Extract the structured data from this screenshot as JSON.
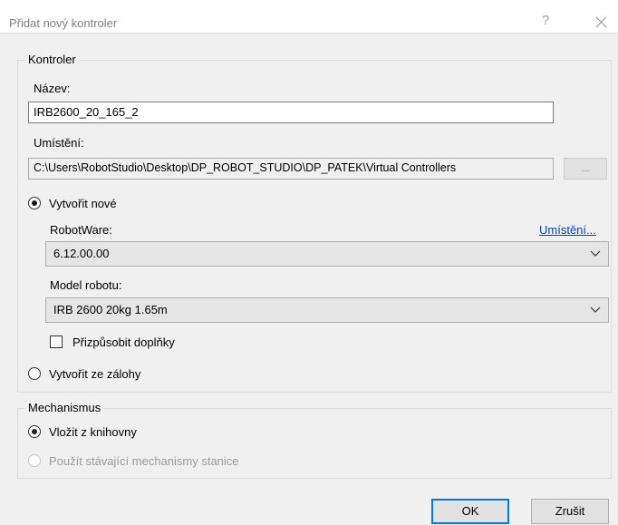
{
  "window": {
    "title": "Přidat nový kontroler",
    "help_label": "?"
  },
  "controller_group": {
    "legend": "Kontroler",
    "name_label": "Název:",
    "name_value": "IRB2600_20_165_2",
    "location_label": "Umístění:",
    "location_value": "C:\\Users\\RobotStudio\\Desktop\\DP_ROBOT_STUDIO\\DP_PATEK\\Virtual Controllers",
    "browse_label": "...",
    "create_new_label": "Vytvořit nové",
    "robotware_label": "RobotWare:",
    "location_link": "Umístění...",
    "robotware_value": "6.12.00.00",
    "robot_model_label": "Model robotu:",
    "robot_model_value": "IRB 2600 20kg 1.65m",
    "customize_options_label": "Přizpůsobit doplňky",
    "create_from_backup_label": "Vytvořit ze zálohy"
  },
  "mechanism_group": {
    "legend": "Mechanismus",
    "insert_library_label": "Vložit z knihovny",
    "use_existing_label": "Použít stávající mechanismy stanice"
  },
  "footer": {
    "ok_label": "OK",
    "cancel_label": "Zrušit"
  }
}
